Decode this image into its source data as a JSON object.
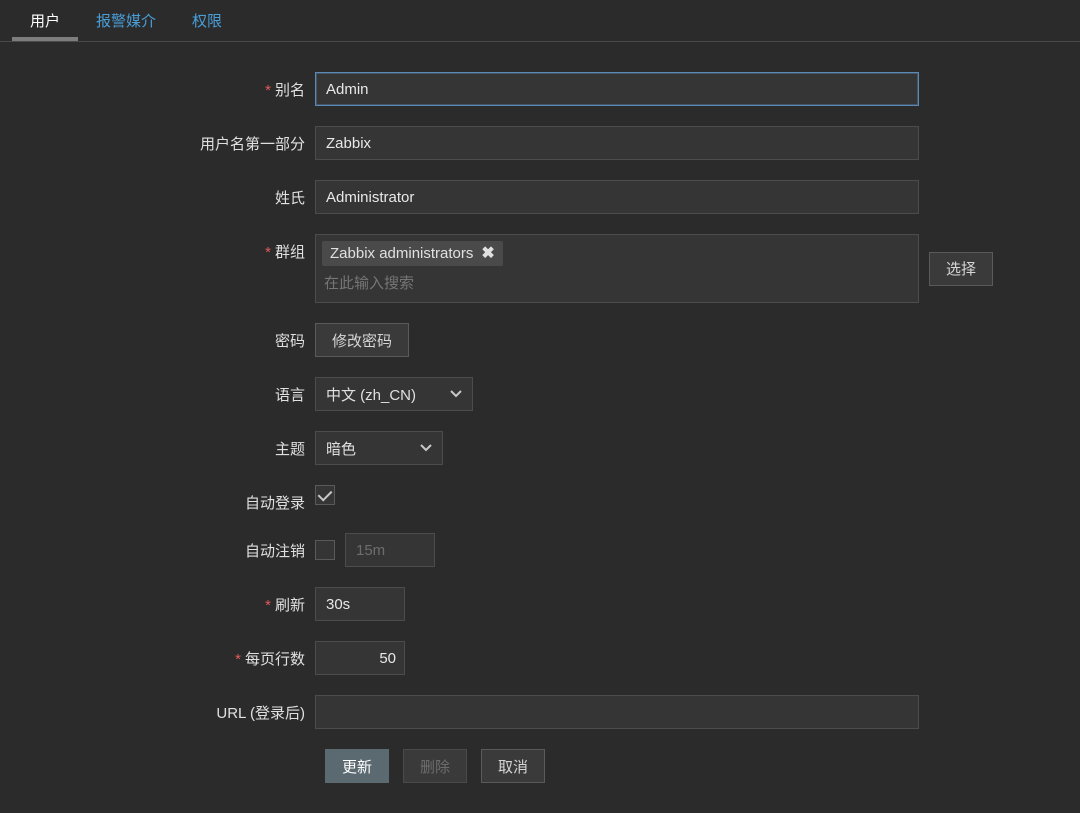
{
  "tabs": {
    "user": "用户",
    "media": "报警媒介",
    "perm": "权限"
  },
  "labels": {
    "alias": "别名",
    "firstname": "用户名第一部分",
    "surname": "姓氏",
    "groups": "群组",
    "password": "密码",
    "language": "语言",
    "theme": "主题",
    "autologin": "自动登录",
    "autologout": "自动注销",
    "refresh": "刷新",
    "rows": "每页行数",
    "url": "URL (登录后)"
  },
  "values": {
    "alias": "Admin",
    "firstname": "Zabbix",
    "surname": "Administrator",
    "group_tag": "Zabbix administrators",
    "group_search_ph": "在此输入搜索",
    "select_btn": "选择",
    "change_pw": "修改密码",
    "language": "中文 (zh_CN)",
    "theme": "暗色",
    "autologout": "15m",
    "refresh": "30s",
    "rows": "50",
    "url": ""
  },
  "buttons": {
    "update": "更新",
    "delete": "删除",
    "cancel": "取消"
  }
}
